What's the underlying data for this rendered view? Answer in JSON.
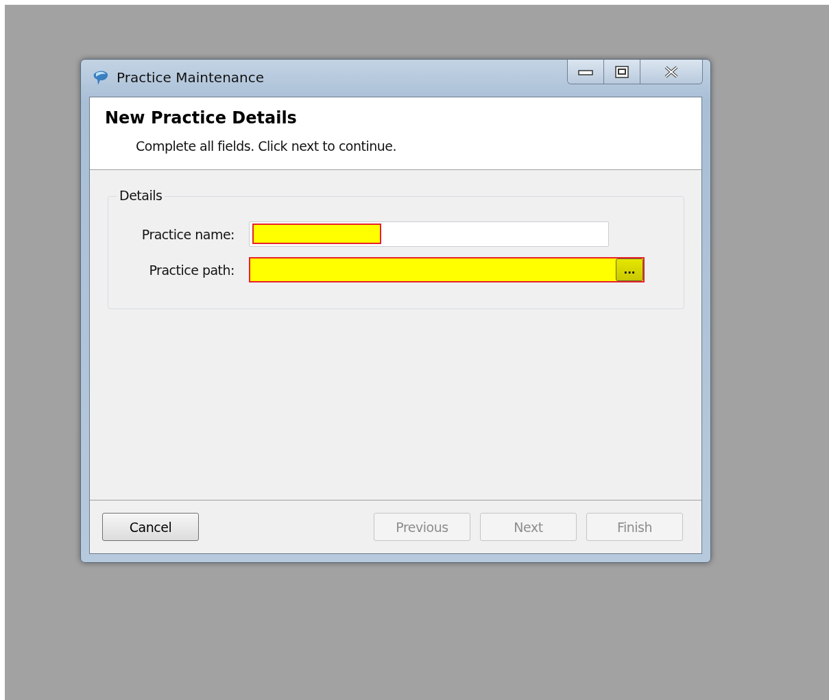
{
  "window": {
    "title": "Practice Maintenance"
  },
  "header": {
    "title": "New Practice Details",
    "subtitle": "Complete all fields. Click next to continue."
  },
  "group": {
    "title": "Details"
  },
  "fields": [
    {
      "kind": "text",
      "label": "Practice name:",
      "highlighted": true
    },
    {
      "kind": "browse",
      "label": "Practice path:",
      "button": "...",
      "highlighted": true
    }
  ],
  "buttons": [
    {
      "label": "Cancel",
      "disabled": false
    },
    {
      "label": "Previous",
      "disabled": true
    },
    {
      "label": "Next",
      "disabled": true
    },
    {
      "label": "Finish",
      "disabled": true
    }
  ]
}
